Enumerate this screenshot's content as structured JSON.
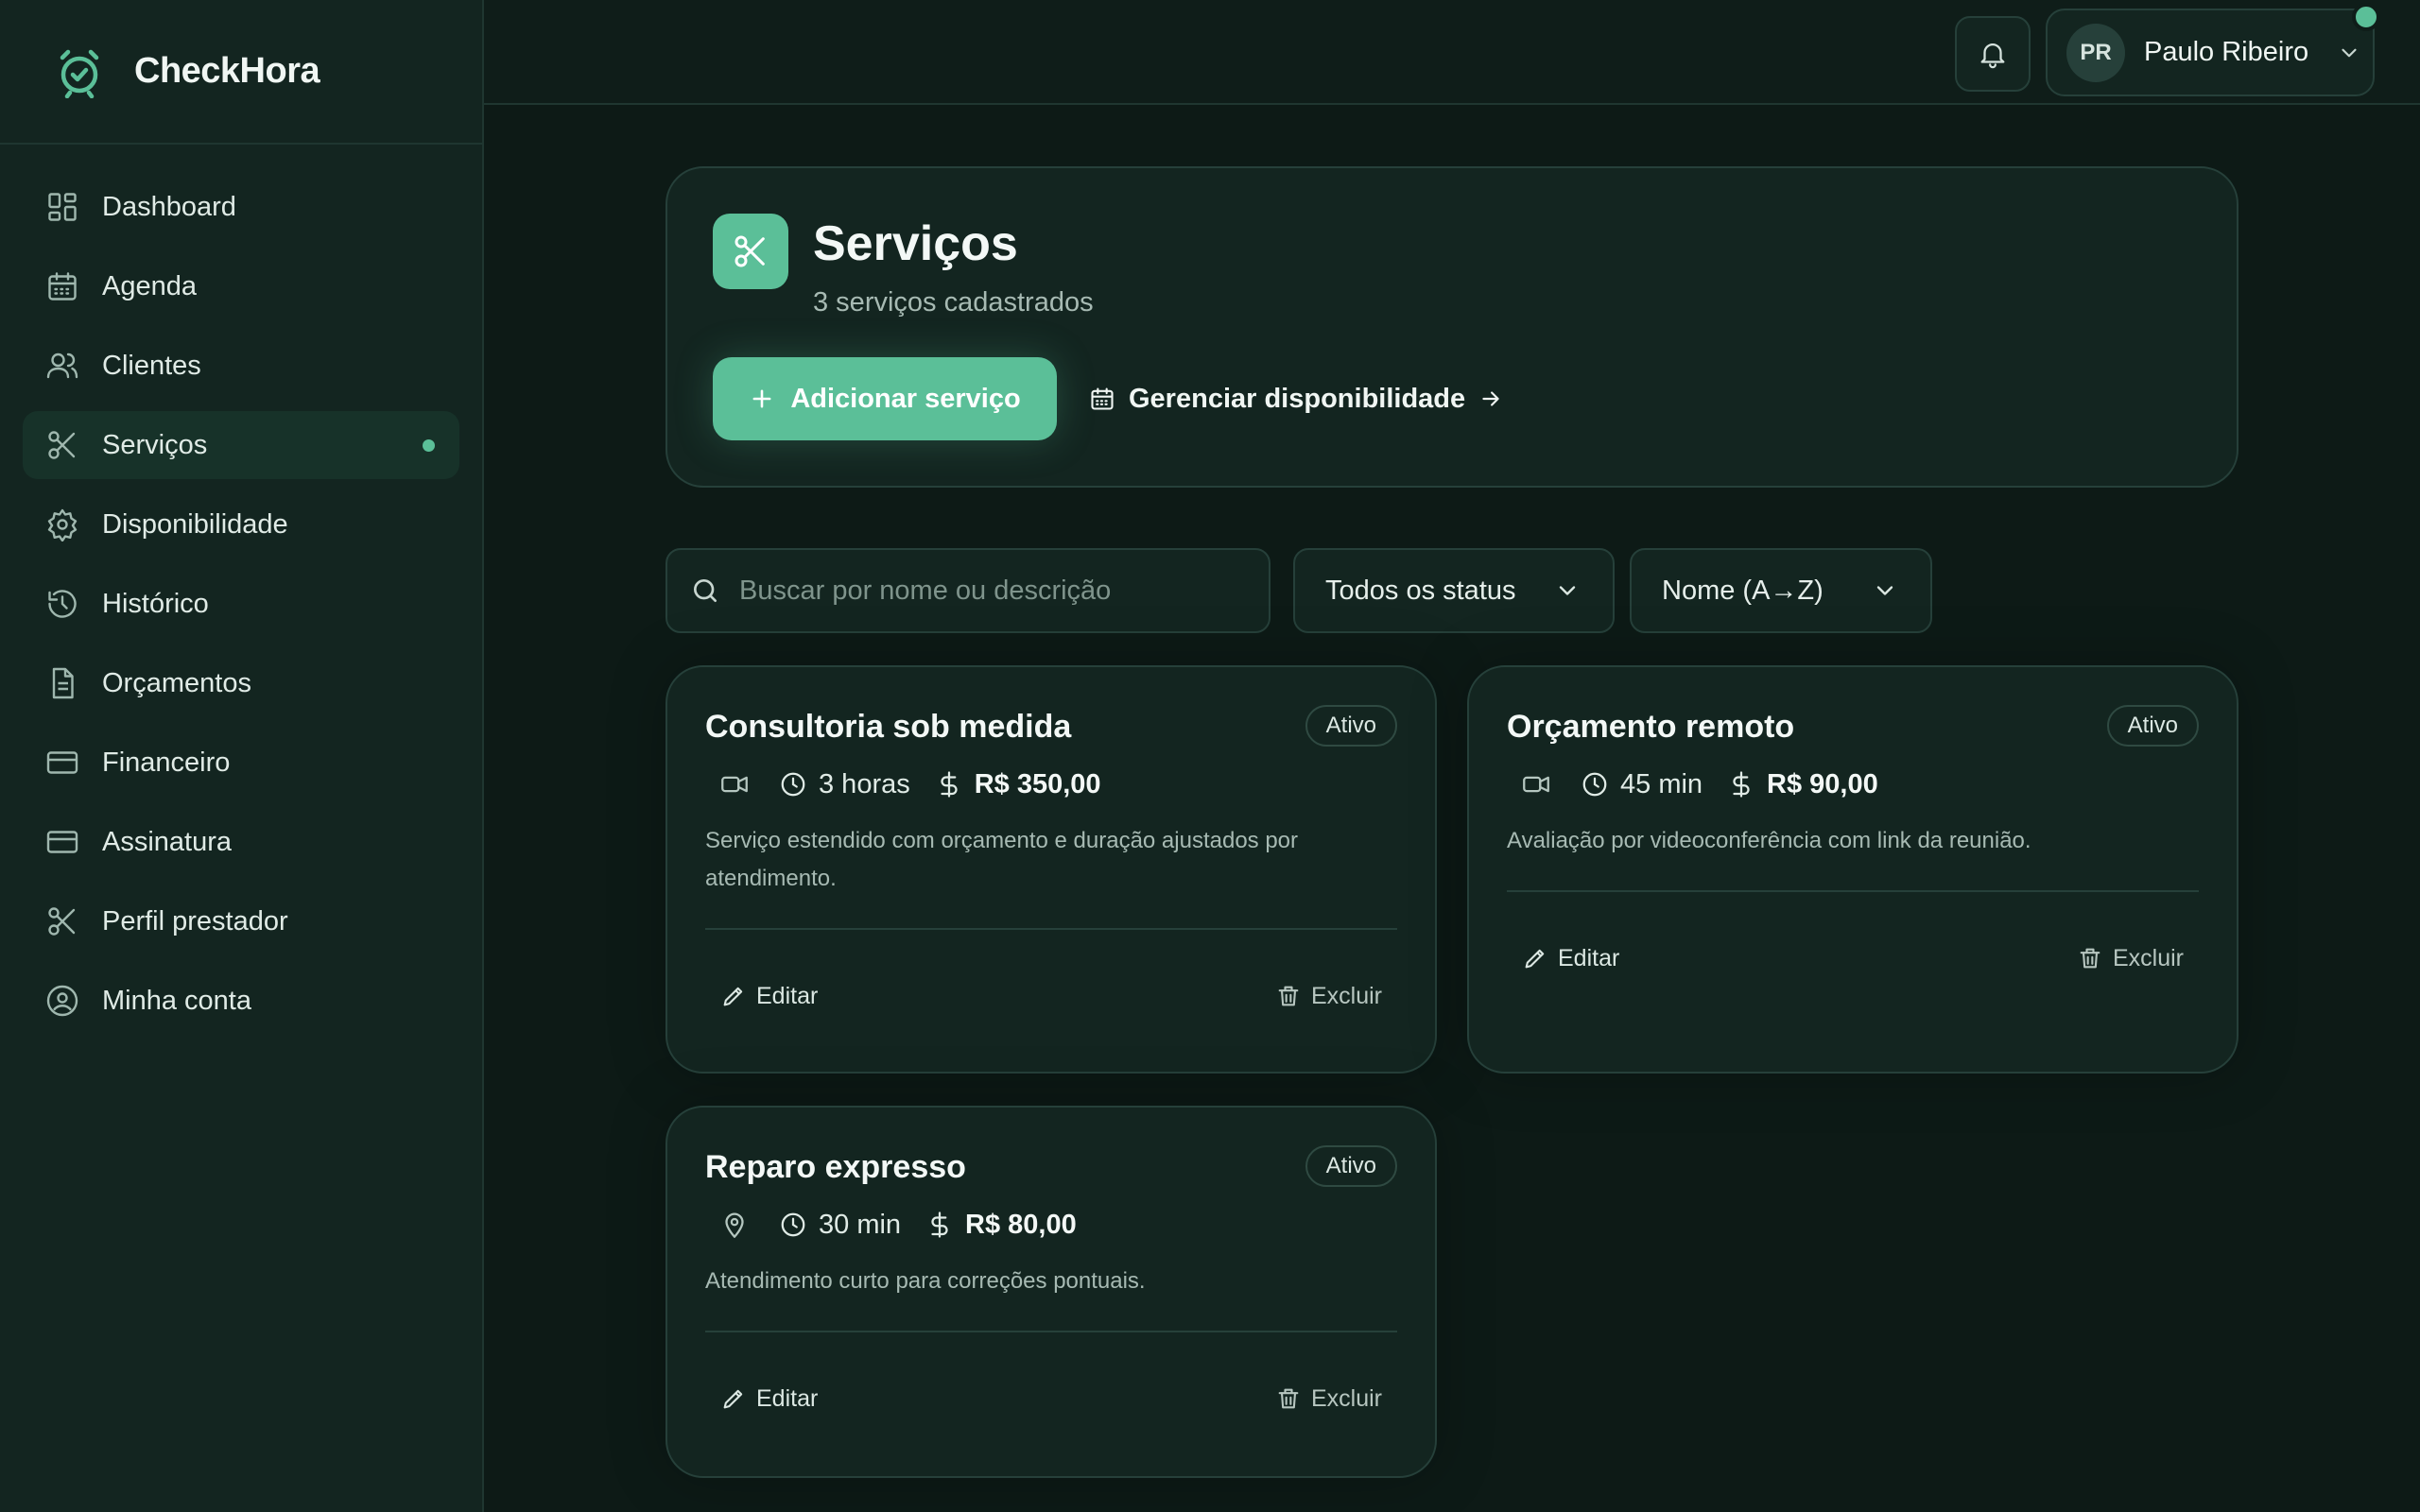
{
  "app": {
    "name": "CheckHora"
  },
  "sidebar": {
    "items": [
      {
        "label": "Dashboard",
        "icon": "dashboard-icon"
      },
      {
        "label": "Agenda",
        "icon": "calendar-icon"
      },
      {
        "label": "Clientes",
        "icon": "users-icon"
      },
      {
        "label": "Serviços",
        "icon": "scissors-icon",
        "active": true
      },
      {
        "label": "Disponibilidade",
        "icon": "gear-icon"
      },
      {
        "label": "Histórico",
        "icon": "history-icon"
      },
      {
        "label": "Orçamentos",
        "icon": "document-icon"
      },
      {
        "label": "Financeiro",
        "icon": "card-icon"
      },
      {
        "label": "Assinatura",
        "icon": "card-icon"
      },
      {
        "label": "Perfil prestador",
        "icon": "scissors-icon"
      },
      {
        "label": "Minha conta",
        "icon": "user-circle-icon"
      }
    ]
  },
  "topbar": {
    "user": {
      "initials": "PR",
      "name": "Paulo Ribeiro"
    }
  },
  "header": {
    "title": "Serviços",
    "subtitle": "3 serviços cadastrados",
    "add_button": "Adicionar serviço",
    "availability_link": "Gerenciar disponibilidade"
  },
  "filters": {
    "search_placeholder": "Buscar por nome ou descrição",
    "status_selected": "Todos os status",
    "sort_selected": "Nome (A→Z)"
  },
  "services": [
    {
      "title": "Consultoria sob medida",
      "status": "Ativo",
      "mode_icon": "video-icon",
      "duration": "3 horas",
      "price": "R$ 350,00",
      "description": "Serviço estendido com orçamento e duração ajustados por atendimento.",
      "edit_label": "Editar",
      "delete_label": "Excluir"
    },
    {
      "title": "Orçamento remoto",
      "status": "Ativo",
      "mode_icon": "video-icon",
      "duration": "45 min",
      "price": "R$ 90,00",
      "description": "Avaliação por videoconferência com link da reunião.",
      "edit_label": "Editar",
      "delete_label": "Excluir"
    },
    {
      "title": "Reparo expresso",
      "status": "Ativo",
      "mode_icon": "location-pin-icon",
      "duration": "30 min",
      "price": "R$ 80,00",
      "description": "Atendimento curto para correções pontuais.",
      "edit_label": "Editar",
      "delete_label": "Excluir"
    }
  ],
  "colors": {
    "accent": "#5bbf98",
    "background": "#0d1a16",
    "sidebar": "#132520",
    "card": "#132520",
    "border": "#26403a"
  }
}
